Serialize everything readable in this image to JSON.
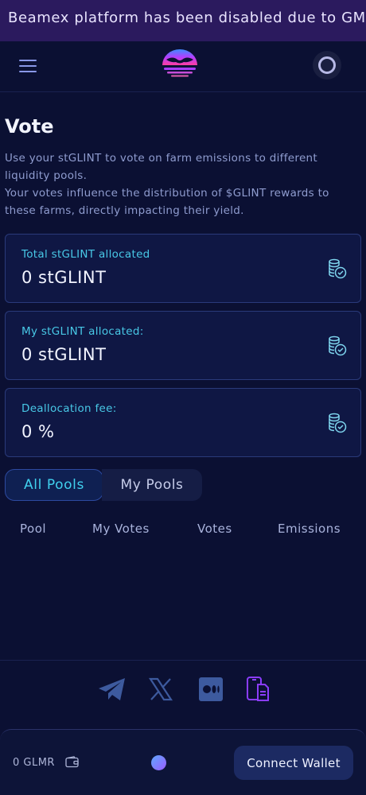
{
  "banner": {
    "text": "Beamex platform has been disabled due to GM"
  },
  "header": {
    "menu_icon": "hamburger-icon",
    "logo_icon": "beamex-logo-icon",
    "avatar_icon": "user-avatar-icon"
  },
  "page": {
    "title": "Vote",
    "description_1": "Use your stGLINT to vote on farm emissions to different liquidity pools.",
    "description_2": "Your votes influence the distribution of $GLINT rewards to these farms, directly impacting their yield."
  },
  "stats": [
    {
      "label": "Total stGLINT allocated",
      "value": "0 stGLINT",
      "icon": "coins-icon"
    },
    {
      "label": "My stGLINT allocated:",
      "value": "0 stGLINT",
      "icon": "coins-icon"
    },
    {
      "label": "Deallocation fee:",
      "value": "0 %",
      "icon": "coins-icon"
    }
  ],
  "tabs": [
    {
      "label": "All Pools",
      "active": true
    },
    {
      "label": "My Pools",
      "active": false
    }
  ],
  "table": {
    "columns": [
      "Pool",
      "My Votes",
      "Votes",
      "Emissions"
    ]
  },
  "social": [
    "telegram-icon",
    "x-icon",
    "medium-icon",
    "docs-icon"
  ],
  "bottom_bar": {
    "balance": "0 GLMR",
    "connect_label": "Connect Wallet"
  },
  "colors": {
    "accent": "#40d0ee",
    "background": "#0b1033",
    "banner": "#2b1a5e",
    "docs_icon": "#8b3dff"
  }
}
